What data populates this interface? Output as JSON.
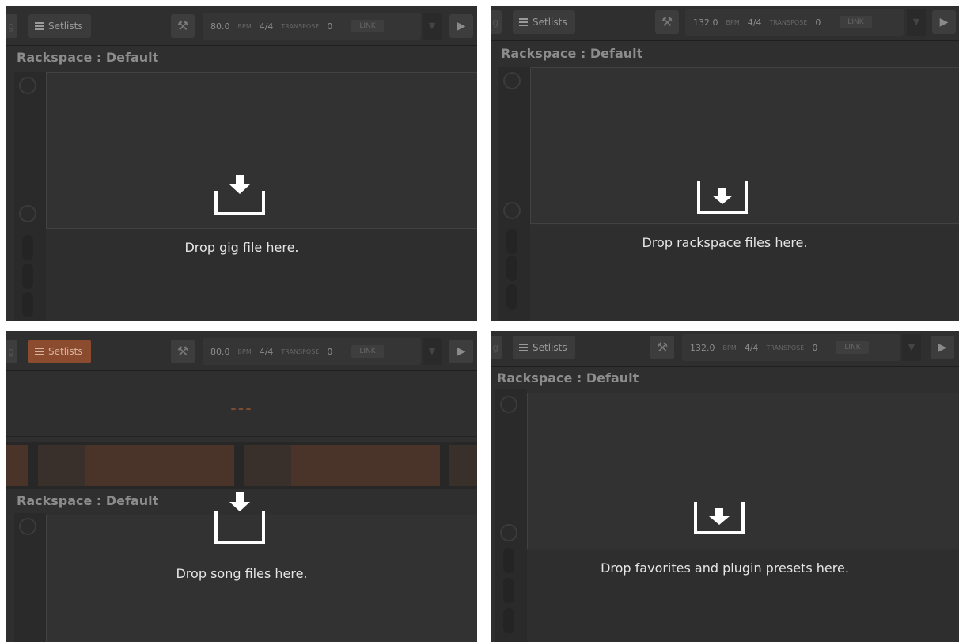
{
  "toolbar": {
    "setlists_label": "Setlists",
    "time_signature": "4/4",
    "bpm_unit": "BPM",
    "transpose_label": "TRANSPOSE",
    "transpose_value": "0",
    "link_label": "LINK"
  },
  "panels": [
    {
      "bpm": "80.0",
      "rackspace_title": "Rackspace : Default",
      "drop_text": "Drop gig file here."
    },
    {
      "bpm": "132.0",
      "rackspace_title": "Rackspace : Default",
      "drop_text": "Drop rackspace files here."
    },
    {
      "bpm": "80.0",
      "rackspace_title": "Rackspace : Default",
      "drop_text": "Drop song files here.",
      "song_placeholder": "---"
    },
    {
      "bpm": "132.0",
      "rackspace_title": "Rackspace : Default",
      "drop_text": "Drop favorites and plugin presets here."
    }
  ],
  "colors": {
    "panel_bg": "#2f2f2f",
    "setlists_active": "#8a4b2f",
    "drop_text": "#e6e6e6"
  },
  "icons": {
    "setlists": "list-icon",
    "tools": "wrench-icon",
    "play": "play-icon",
    "drop": "download-tray-icon"
  }
}
